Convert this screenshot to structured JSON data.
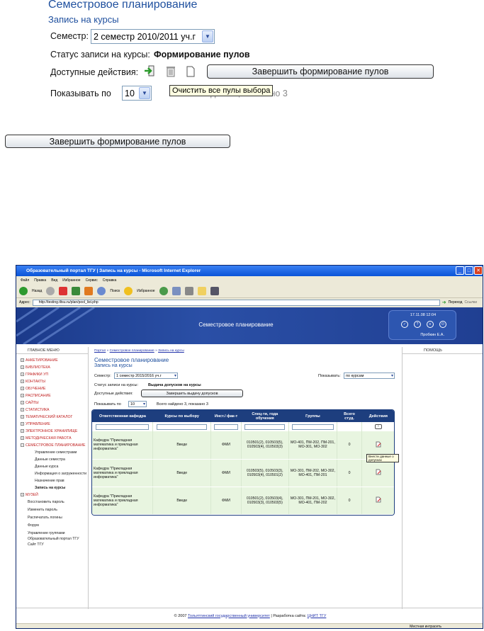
{
  "page_title": "Семестровое планирование",
  "page_subtitle": "Запись на курсы",
  "semester": {
    "label": "Семестр:",
    "value": "2 семестр 2010/2011 уч.г"
  },
  "status": {
    "label": "Статус записи на курсы:",
    "value": "Формирование пулов"
  },
  "actions": {
    "label": "Доступные действия:",
    "button": "Завершить формирование пулов",
    "tooltip": "Очистить все пулы выбора"
  },
  "show": {
    "label": "Показывать по",
    "value": "10",
    "found": "Всего найдено 3, показано 3"
  },
  "standalone_button": "Завершить формирование пулов",
  "browser": {
    "title": "Образовательный портал ТГУ | Запись на курсы - Microsoft Internet Explorer",
    "menu": [
      "Файл",
      "Правка",
      "Вид",
      "Избранное",
      "Сервис",
      "Справка"
    ],
    "toolbar": {
      "back": "Назад",
      "search": "Поиск",
      "favorites": "Избранное"
    },
    "address_label": "Адрес:",
    "url": "http://testing.tltsu.ru/plan/pool_list.php",
    "go": "Переход",
    "links": "Ссылки",
    "status_zone": "Местная интрасеть"
  },
  "portal": {
    "banner_title": "Семестровое планирование",
    "datetime": "17.11.08 12:04",
    "user": "Пробкин Е.А.",
    "left_header": "ГЛАВНОЕ МЕНЮ",
    "right_header": "ПОМОЩЬ",
    "menu": [
      {
        "label": "АНКЕТИРОВАНИЕ",
        "sign": "+"
      },
      {
        "label": "БИБЛИОТЕКА",
        "sign": "+"
      },
      {
        "label": "ГРАФИКИ УП",
        "sign": "+"
      },
      {
        "label": "КОНТАКТЫ",
        "sign": "+"
      },
      {
        "label": "ОБУЧЕНИЕ",
        "sign": "+"
      },
      {
        "label": "РАСПИСАНИЕ",
        "sign": "+"
      },
      {
        "label": "САЙТЫ",
        "sign": "+"
      },
      {
        "label": "СТАТИСТИКА",
        "sign": "+"
      },
      {
        "label": "ТЕМАТИЧЕСКИЙ КАТАЛОГ",
        "sign": "+"
      },
      {
        "label": "УПРАВЛЕНИЕ",
        "sign": "+"
      },
      {
        "label": "ЭЛЕКТРОННОЕ ХРАНИЛИЩЕ",
        "sign": "+"
      },
      {
        "label": "МЕТОДИЧЕСКАЯ РАБОТА",
        "sign": "+"
      },
      {
        "label": "СЕМЕСТРОВОЕ ПЛАНИРОВАНИЕ",
        "sign": "−"
      }
    ],
    "submenu": [
      "Управление семестрами",
      "Данные семестра",
      "Данные курса",
      "Информация о загруженности",
      "Назначение прав",
      "Запись на курсы"
    ],
    "museum": "МУЗЕЙ",
    "extra": [
      "Восстановить пароль",
      "Изменить пароль",
      "Распечатать логины",
      "Форум",
      "Управление группами",
      "Образовательный портал ТГУ",
      "Сайт ТГУ"
    ],
    "breadcrumb": [
      "Портал",
      "Семестровое планирование",
      "Запись на курсы"
    ],
    "title": "Семестровое планирование",
    "subtitle": "Запись на курсы",
    "semester_label": "Семестр:",
    "semester_value": "1 семестр 2015/2016 уч.г",
    "show_label": "Показывать:",
    "show_value": "по курсам",
    "status_label": "Статус записи на курсы:",
    "status_value": "Выдача допусков на курсы",
    "actions_label": "Доступные действия:",
    "actions_button": "Завершить выдачу допусков",
    "perpage_label": "Показывать по",
    "perpage_value": "10",
    "found": "Всего найдено 3, показано 3",
    "columns": [
      "Ответственная кафедра",
      "Курсы по выбору",
      "Инст./ фак-т",
      "Спец-ти, года обучения",
      "Группы",
      "Всего студ.",
      "Действия"
    ],
    "rows": [
      {
        "dept": "Кафедра \"Прикладная математика и прикладная информатика\"",
        "course": "Введе",
        "inst": "ФМИ",
        "spec": "010501(2), 010503(5), 010503(4), 010503(3)",
        "groups": "МО-401, ПМ-202, ПМ-201, МО-301, МО-302",
        "total": "0"
      },
      {
        "dept": "Кафедра \"Прикладная математика и прикладная информатика\"",
        "course": "Введе",
        "inst": "ФМИ",
        "spec": "010503(5), 010503(3), 010503(4), 010501(2)",
        "groups": "МО-301, ПМ-202, МО-302, МО-401, ПМ-201",
        "total": "0"
      },
      {
        "dept": "Кафедра \"Прикладная математика и прикладная информатика\"",
        "course": "Введе",
        "inst": "ФМИ",
        "spec": "010501(2), 010503(4), 010503(3), 010503(5)",
        "groups": "МО-301, ПМ-201, МО-302, МО-401, ПМ-202",
        "total": "0"
      }
    ],
    "row_tooltip": "Внести данные о допусках",
    "footer_prefix": "© 2007",
    "footer_uni": "Тольяттинский государственный университет",
    "footer_mid": "| Разработка сайта:",
    "footer_dev": "ЦНИТ ТГУ"
  }
}
